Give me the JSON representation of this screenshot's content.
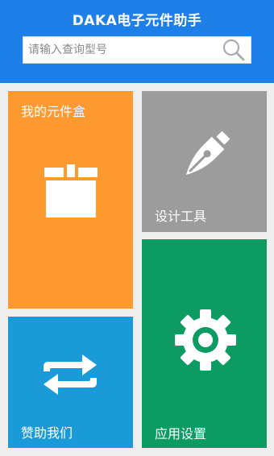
{
  "header": {
    "title": "DAKA电子元件助手",
    "color": "#1e7fe8"
  },
  "search": {
    "placeholder": "请输入查询型号",
    "value": "",
    "icon": "search-icon"
  },
  "tiles": [
    {
      "label": "我的元件盒",
      "icon": "box-icon",
      "color": "#fe9a30"
    },
    {
      "label": "设计工具",
      "icon": "pen-nib-icon",
      "color": "#9c9c9c"
    },
    {
      "label": "赞助我们",
      "icon": "swap-arrows-icon",
      "color": "#1a9ad6"
    },
    {
      "label": "应用设置",
      "icon": "gear-icon",
      "color": "#0b9b63"
    }
  ]
}
